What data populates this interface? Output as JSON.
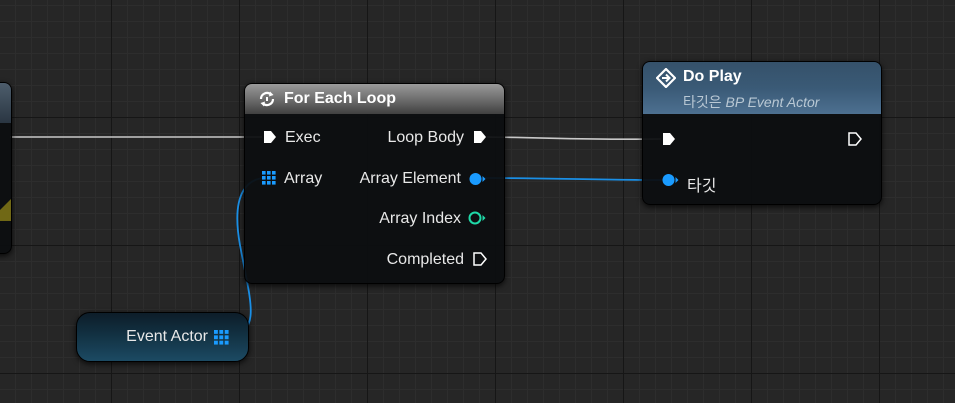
{
  "colors": {
    "exec": "#ffffff",
    "object_pin": "#1a9bff",
    "integer_pin": "#1fd9a8",
    "foreach_header": "#6a6a6a",
    "doplay_header": "#3a5a76"
  },
  "nodes": {
    "for_each_loop": {
      "title": "For Each Loop",
      "icon": "loop-icon",
      "inputs": {
        "exec": "Exec",
        "array": "Array"
      },
      "outputs": {
        "loop_body": "Loop Body",
        "array_element": "Array Element",
        "array_index": "Array Index",
        "completed": "Completed"
      }
    },
    "do_play": {
      "title": "Do Play",
      "icon": "function-icon",
      "subtitle_prefix": "타깃은 ",
      "subtitle_target": "BP Event Actor",
      "inputs": {
        "target": "타깃"
      }
    },
    "event_actor": {
      "label": "Event Actor",
      "icon": "array-grid-icon"
    }
  },
  "wires": [
    {
      "from": "offscreen-node.exec-out",
      "to": "for-each-loop.exec-in",
      "type": "exec"
    },
    {
      "from": "for-each-loop.loop-body",
      "to": "do-play.exec-in",
      "type": "exec"
    },
    {
      "from": "for-each-loop.array-element",
      "to": "do-play.target",
      "type": "object"
    },
    {
      "from": "event-actor.out",
      "to": "for-each-loop.array",
      "type": "object"
    }
  ]
}
